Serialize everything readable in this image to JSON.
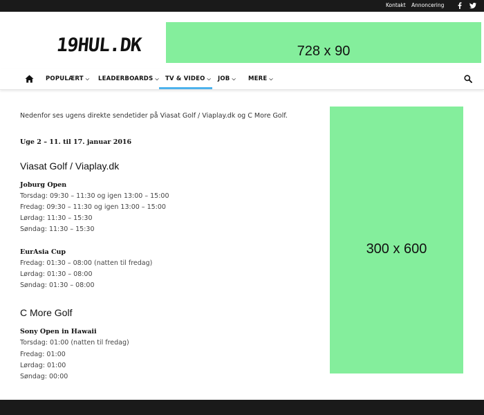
{
  "topbar": {
    "links": [
      "Kontakt",
      "Annoncering"
    ],
    "social_icons": [
      "facebook-icon",
      "twitter-icon"
    ]
  },
  "header": {
    "logo_text": "19HUL.DK",
    "banner_label": "728 x 90"
  },
  "nav": {
    "home_icon": "home-icon",
    "items": [
      {
        "label": "POPULÆRT"
      },
      {
        "label": "LEADERBOARDS"
      },
      {
        "label": "TV & VIDEO",
        "active": true
      },
      {
        "label": "JOB"
      },
      {
        "label": "MERE"
      }
    ],
    "search_icon": "search-icon",
    "accent_color": "#4db2ec"
  },
  "article": {
    "intro": "Nedenfor ses ugens direkte sendetider på Viasat Golf / Viaplay.dk og C More Golf.",
    "week": "Uge 2 – 11. til 17. januar 2016",
    "sections": [
      {
        "channel": "Viasat Golf / Viaplay.dk",
        "events": [
          {
            "name": "Joburg Open",
            "times": [
              "Torsdag: 09:30 – 11:30 og igen 13:00 – 15:00",
              "Fredag: 09:30 – 11:30 og igen 13:00 – 15:00",
              "Lørdag: 11:30 – 15:30",
              "Søndag: 11:30 – 15:30"
            ]
          },
          {
            "name": "EurAsia Cup",
            "times": [
              "Fredag: 01:30 – 08:00 (natten til fredag)",
              "Lørdag: 01:30 – 08:00",
              "Søndag: 01:30 – 08:00"
            ]
          }
        ]
      },
      {
        "channel": "C More Golf",
        "events": [
          {
            "name": "Sony Open in Hawaii",
            "times": [
              "Torsdag: 01:00 (natten til fredag)",
              "Fredag: 01:00",
              "Lørdag: 01:00",
              "Søndag: 00:00"
            ]
          }
        ]
      }
    ]
  },
  "sidebar": {
    "ad_label": "300 x 600",
    "ad_color": "#84ee9c"
  }
}
